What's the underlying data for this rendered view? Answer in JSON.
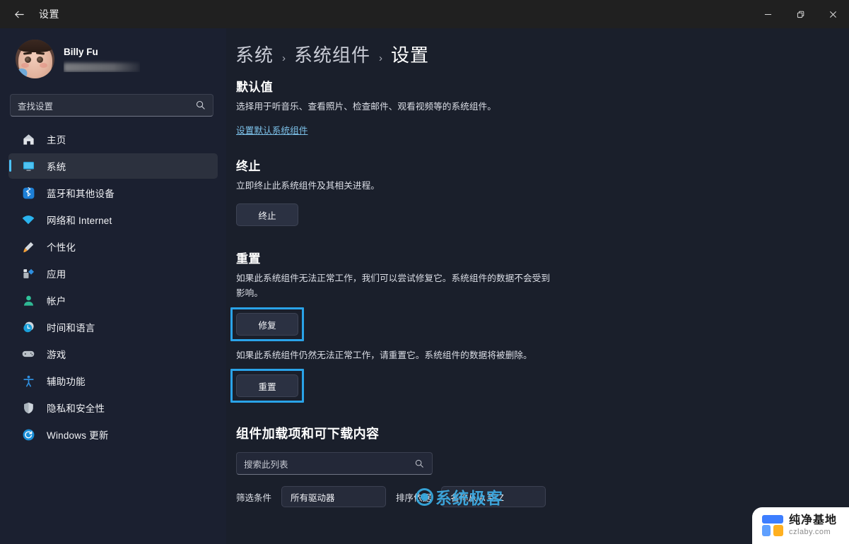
{
  "window": {
    "title": "设置",
    "back_icon": "back-arrow-icon",
    "minimize_icon": "minimize-icon",
    "maximize_icon": "restore-icon",
    "close_icon": "close-icon"
  },
  "sidebar": {
    "profile": {
      "name": "Billy Fu",
      "email_masked": ""
    },
    "search": {
      "placeholder": "查找设置",
      "icon": "search-icon"
    },
    "items": [
      {
        "label": "主页",
        "icon": "home-icon",
        "selected": false
      },
      {
        "label": "系统",
        "icon": "system-display-icon",
        "selected": true
      },
      {
        "label": "蓝牙和其他设备",
        "icon": "bluetooth-icon",
        "selected": false
      },
      {
        "label": "网络和 Internet",
        "icon": "wifi-icon",
        "selected": false
      },
      {
        "label": "个性化",
        "icon": "paintbrush-icon",
        "selected": false
      },
      {
        "label": "应用",
        "icon": "apps-icon",
        "selected": false
      },
      {
        "label": "帐户",
        "icon": "account-person-icon",
        "selected": false
      },
      {
        "label": "时间和语言",
        "icon": "clock-icon",
        "selected": false
      },
      {
        "label": "游戏",
        "icon": "gamepad-icon",
        "selected": false
      },
      {
        "label": "辅助功能",
        "icon": "accessibility-icon",
        "selected": false
      },
      {
        "label": "隐私和安全性",
        "icon": "shield-icon",
        "selected": false
      },
      {
        "label": "Windows 更新",
        "icon": "update-refresh-icon",
        "selected": false
      }
    ]
  },
  "main": {
    "breadcrumb": [
      "系统",
      "系统组件",
      "设置"
    ],
    "breadcrumb_separator": "›",
    "sections": {
      "defaults": {
        "heading": "默认值",
        "description": "选择用于听音乐、查看照片、检查邮件、观看视频等的系统组件。",
        "link": "设置默认系统组件"
      },
      "terminate": {
        "heading": "终止",
        "description": "立即终止此系统组件及其相关进程。",
        "button": "终止"
      },
      "reset": {
        "heading": "重置",
        "repair_description": "如果此系统组件无法正常工作，我们可以尝试修复它。系统组件的数据不会受到影响。",
        "repair_button": "修复",
        "reset_description": "如果此系统组件仍然无法正常工作，请重置它。系统组件的数据将被删除。",
        "reset_button": "重置"
      },
      "addons": {
        "heading": "组件加载项和可下载内容",
        "search_placeholder": "搜索此列表",
        "search_icon": "search-icon",
        "filter_label": "筛选条件",
        "filter_value": "所有驱动器",
        "sort_label": "排序依据",
        "sort_value": "名称从 A 到 Z"
      }
    }
  },
  "watermarks": {
    "geek": {
      "text": "系统极客",
      "color": "#3ea9e0"
    },
    "czlaby": {
      "title": "纯净基地",
      "domain": "czlaby.com"
    }
  },
  "colors": {
    "accent": "#4cc2ff",
    "highlight_box": "#2aa3e8",
    "sidebar_bg": "#1b2030",
    "main_bg": "#1a1f2b",
    "titlebar_bg": "#202020",
    "link": "#7cc0e8"
  }
}
